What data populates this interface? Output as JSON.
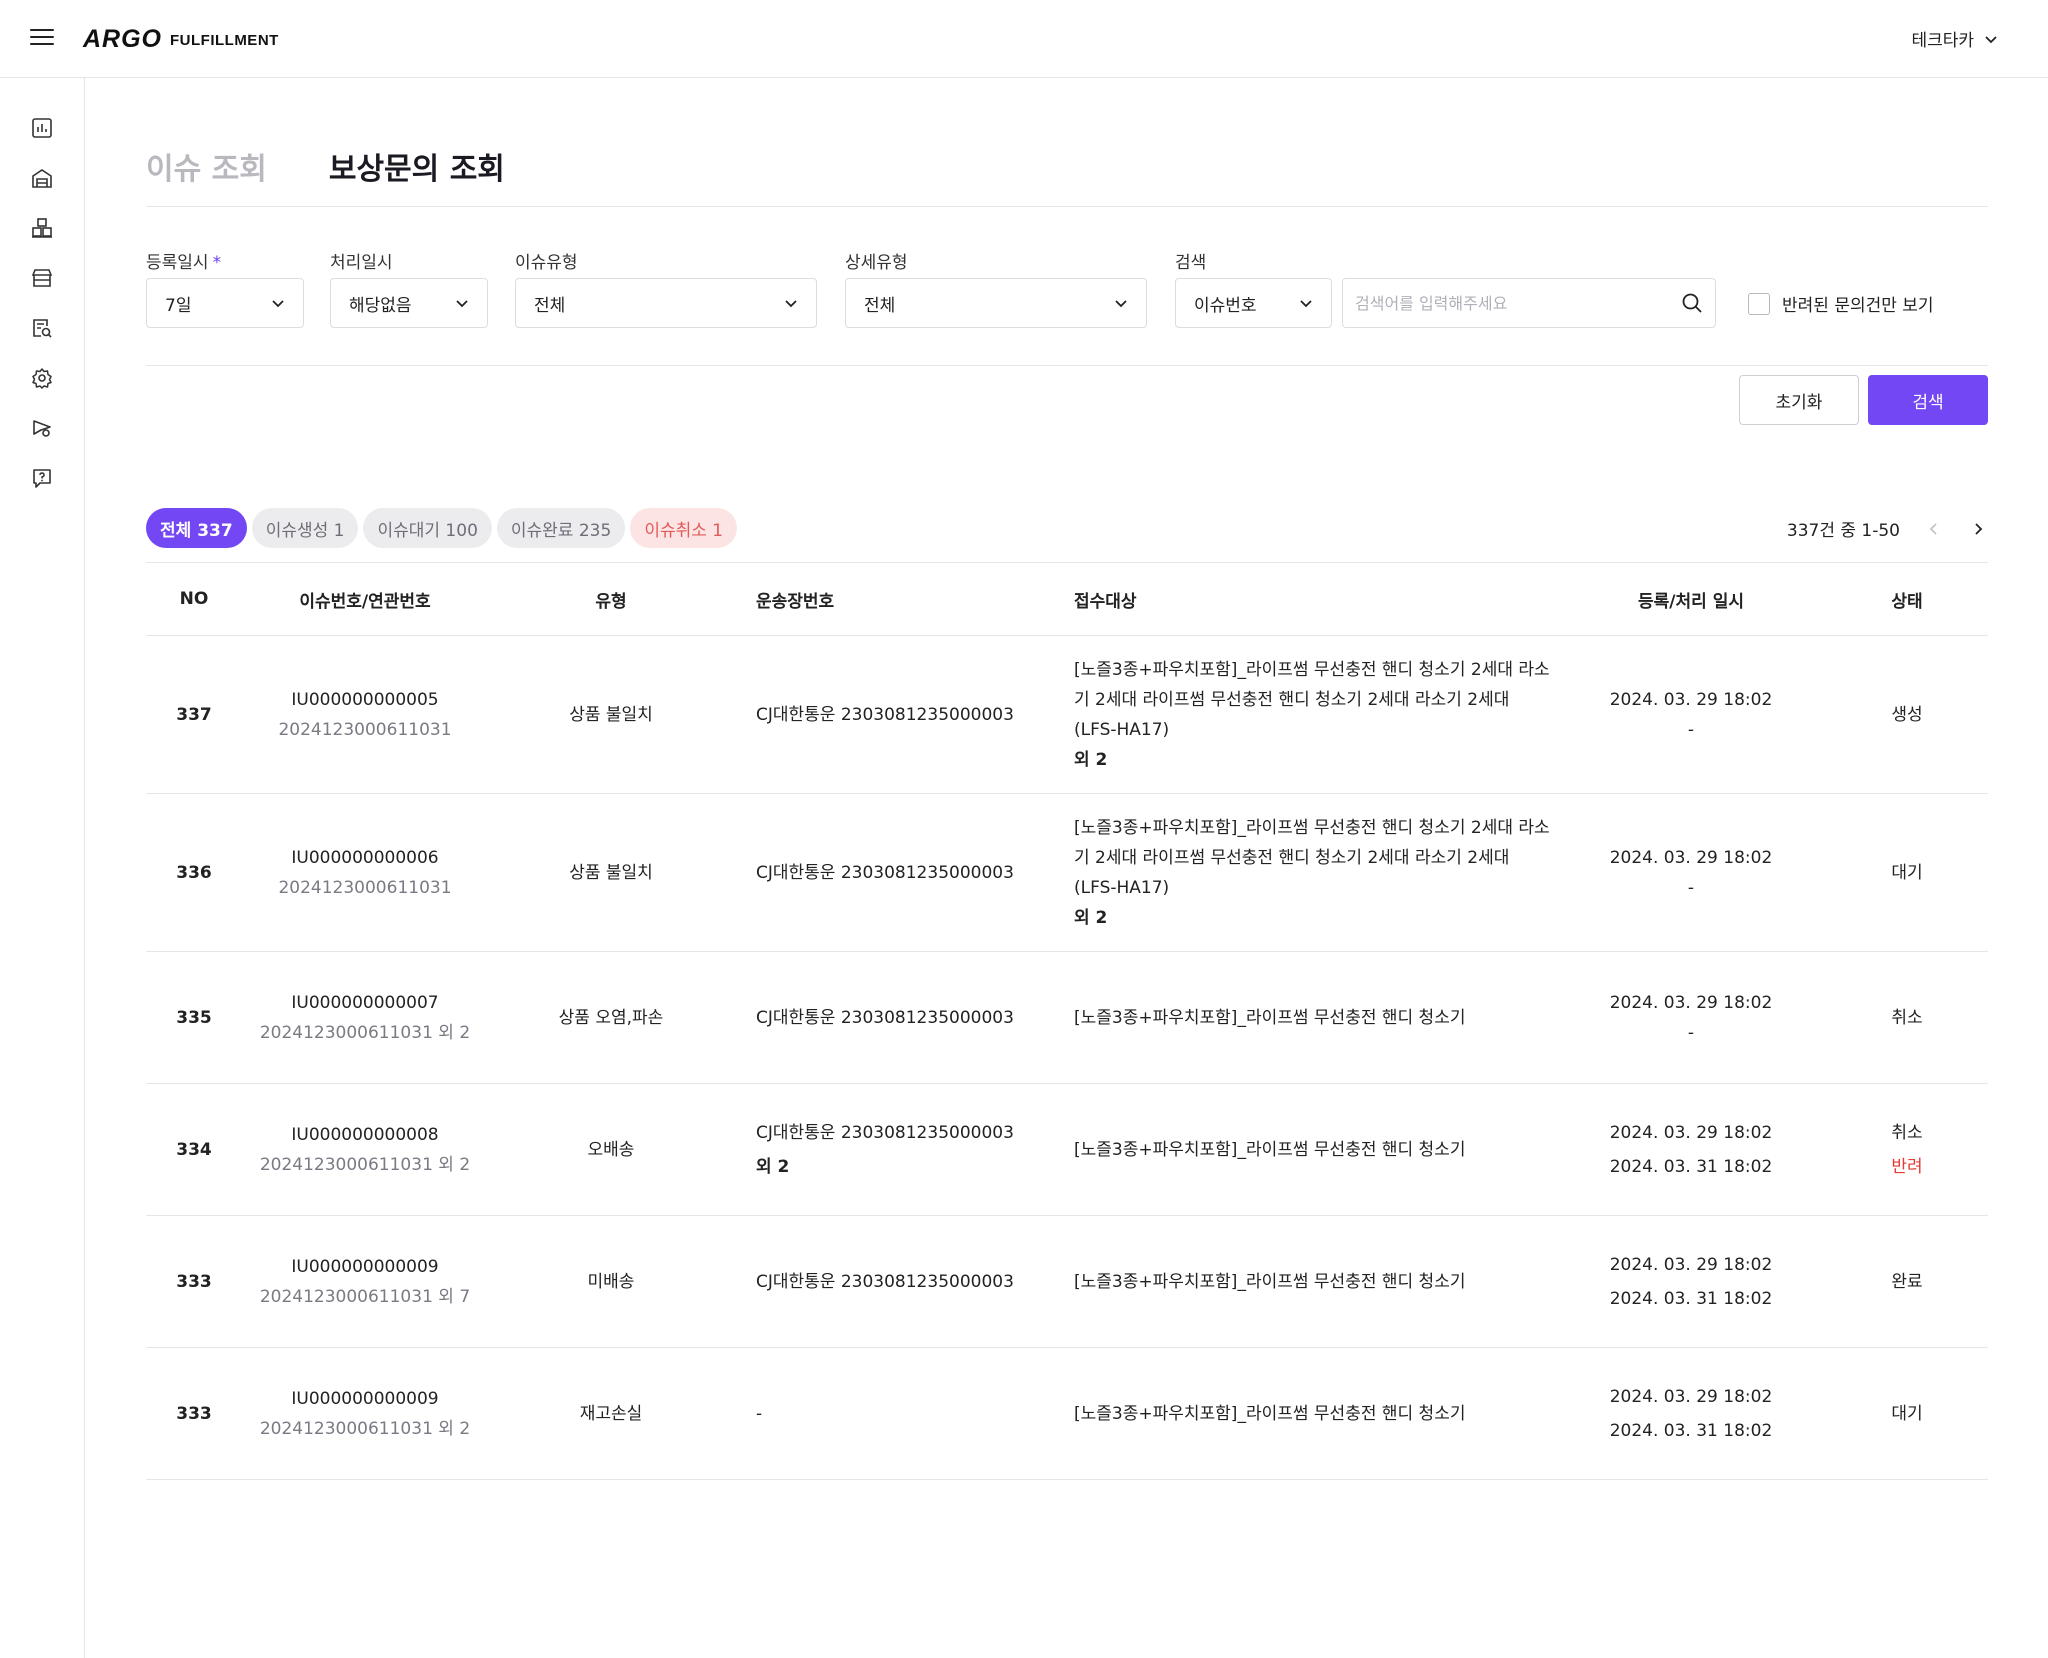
{
  "header": {
    "logo_mark": "ARGO",
    "logo_sub": "FULFILLMENT",
    "user_name": "테크타카"
  },
  "sidebar": {
    "icons": [
      "dashboard-chart-icon",
      "warehouse-icon",
      "inventory-boxes-icon",
      "store-icon",
      "document-search-icon",
      "settings-gear-icon",
      "marketing-flag-icon",
      "help-chat-icon"
    ]
  },
  "tabs": [
    {
      "label": "이슈 조회",
      "active": false
    },
    {
      "label": "보상문의 조회",
      "active": true
    }
  ],
  "filters": {
    "reg_date": {
      "label": "등록일시",
      "required_mark": "*",
      "value": "7일"
    },
    "proc_date": {
      "label": "처리일시",
      "value": "해당없음"
    },
    "issue_type": {
      "label": "이슈유형",
      "value": "전체"
    },
    "detail_type": {
      "label": "상세유형",
      "value": "전체"
    },
    "search": {
      "label": "검색",
      "field": "이슈번호",
      "placeholder": "검색어를 입력해주세요"
    },
    "returned_only_label": "반려된 문의건만 보기"
  },
  "buttons": {
    "reset": "초기화",
    "search": "검색"
  },
  "chips": [
    {
      "label": "전체 337",
      "style": "active"
    },
    {
      "label": "이슈생성 1",
      "style": "normal"
    },
    {
      "label": "이슈대기 100",
      "style": "normal"
    },
    {
      "label": "이슈완료 235",
      "style": "normal"
    },
    {
      "label": "이슈취소 1",
      "style": "cancel"
    }
  ],
  "pagination": {
    "summary": "337건 중 1-50"
  },
  "table": {
    "headers": {
      "no": "NO",
      "issue": "이슈번호/연관번호",
      "type": "유형",
      "waybill": "운송장번호",
      "target": "접수대상",
      "date": "등록/처리 일시",
      "status": "상태"
    },
    "rows": [
      {
        "no": "337",
        "issue_no": "IU000000000005",
        "related_no": "2024123000611031",
        "type": "상품 불일치",
        "waybill": "CJ대한통운 2303081235000003",
        "waybill_extra": "",
        "target": "[노즐3종+파우치포함]_라이프썸 무선충전 핸디 청소기 2세대 라소기 2세대 라이프썸 무선충전 핸디 청소기 2세대 라소기 2세대  (LFS-HA17)",
        "target_extra": "외 2",
        "reg_date": "2024. 03. 29 18:02",
        "proc_date": "-",
        "status": "생성",
        "status_extra": ""
      },
      {
        "no": "336",
        "issue_no": "IU000000000006",
        "related_no": "2024123000611031",
        "type": "상품 불일치",
        "waybill": "CJ대한통운 2303081235000003",
        "waybill_extra": "",
        "target": "[노즐3종+파우치포함]_라이프썸 무선충전 핸디 청소기 2세대 라소기 2세대 라이프썸 무선충전 핸디 청소기 2세대 라소기 2세대  (LFS-HA17)",
        "target_extra": "외 2",
        "reg_date": "2024. 03. 29 18:02",
        "proc_date": "-",
        "status": "대기",
        "status_extra": ""
      },
      {
        "no": "335",
        "issue_no": "IU000000000007",
        "related_no": "2024123000611031 외 2",
        "type": "상품 오염,파손",
        "waybill": "CJ대한통운 2303081235000003",
        "waybill_extra": "",
        "target": "[노즐3종+파우치포함]_라이프썸 무선충전 핸디 청소기",
        "target_extra": "",
        "reg_date": "2024. 03. 29 18:02",
        "proc_date": "-",
        "status": "취소",
        "status_extra": ""
      },
      {
        "no": "334",
        "issue_no": "IU000000000008",
        "related_no": "2024123000611031 외 2",
        "type": "오배송",
        "waybill": "CJ대한통운 2303081235000003",
        "waybill_extra": "외 2",
        "target": "[노즐3종+파우치포함]_라이프썸 무선충전 핸디 청소기",
        "target_extra": "",
        "reg_date": "2024. 03. 29 18:02",
        "proc_date": "2024. 03. 31 18:02",
        "status": "취소",
        "status_extra": "반려"
      },
      {
        "no": "333",
        "issue_no": "IU000000000009",
        "related_no": "2024123000611031 외 7",
        "type": "미배송",
        "waybill": "CJ대한통운 2303081235000003",
        "waybill_extra": "",
        "target": "[노즐3종+파우치포함]_라이프썸 무선충전 핸디 청소기",
        "target_extra": "",
        "reg_date": "2024. 03. 29 18:02",
        "proc_date": "2024. 03. 31 18:02",
        "status": "완료",
        "status_extra": ""
      },
      {
        "no": "333",
        "issue_no": "IU000000000009",
        "related_no": "2024123000611031 외 2",
        "type": "재고손실",
        "waybill": "-",
        "waybill_extra": "",
        "target": "[노즐3종+파우치포함]_라이프썸 무선충전 핸디 청소기",
        "target_extra": "",
        "reg_date": "2024. 03. 29 18:02",
        "proc_date": "2024. 03. 31 18:02",
        "status": "대기",
        "status_extra": ""
      }
    ]
  },
  "colors": {
    "accent": "#7447f5",
    "cancel_bg": "#fde4e4",
    "cancel_text": "#e05a5a",
    "returned_text": "#e53935"
  }
}
